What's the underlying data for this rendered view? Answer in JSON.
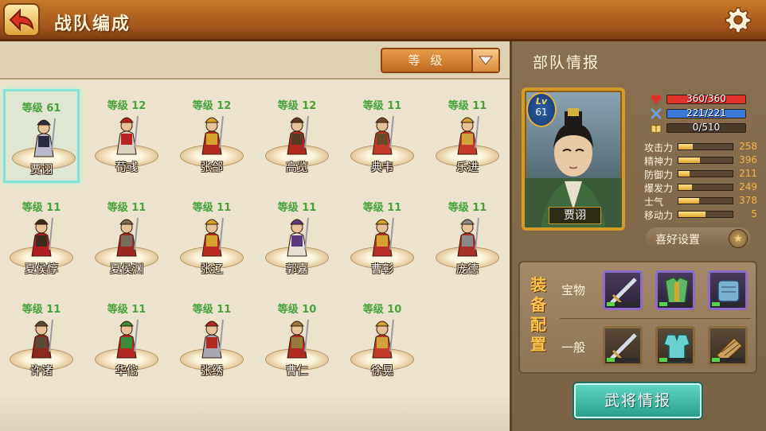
{
  "header": {
    "title": "战队编成",
    "back_icon": "back-arrow-icon",
    "settings_icon": "gear-icon"
  },
  "roster": {
    "sort_label": "等 级",
    "heroes": [
      {
        "level": "等级 61",
        "name": "贾诩",
        "color": "#b9b9c9",
        "accent": "#2a2a40",
        "selected": true
      },
      {
        "level": "等级 12",
        "name": "荀彧",
        "color": "#d9d4c0",
        "accent": "#b62222"
      },
      {
        "level": "等级 12",
        "name": "张郃",
        "color": "#b22a1f",
        "accent": "#d4a42c"
      },
      {
        "level": "等级 12",
        "name": "高览",
        "color": "#b22a1f",
        "accent": "#5a3a22"
      },
      {
        "level": "等级 11",
        "name": "典韦",
        "color": "#c33a2a",
        "accent": "#6b4a2a"
      },
      {
        "level": "等级 11",
        "name": "乐进",
        "color": "#c23a2a",
        "accent": "#d2a23a"
      },
      {
        "level": "等级 11",
        "name": "夏侯惇",
        "color": "#b02020",
        "accent": "#3a2a20"
      },
      {
        "level": "等级 11",
        "name": "夏侯渊",
        "color": "#9a2a22",
        "accent": "#7a6a5a"
      },
      {
        "level": "等级 11",
        "name": "张辽",
        "color": "#b82a22",
        "accent": "#d4a42c"
      },
      {
        "level": "等级 11",
        "name": "郭嘉",
        "color": "#e6e0d4",
        "accent": "#5a3a7a"
      },
      {
        "level": "等级 11",
        "name": "曹彰",
        "color": "#b8302a",
        "accent": "#d2a22c"
      },
      {
        "level": "等级 11",
        "name": "庞德",
        "color": "#a8302a",
        "accent": "#8a8a8a"
      },
      {
        "level": "等级 11",
        "name": "许诸",
        "color": "#8a2a1a",
        "accent": "#5a4a3a"
      },
      {
        "level": "等级 11",
        "name": "华佗",
        "color": "#b02a22",
        "accent": "#3a8a3a"
      },
      {
        "level": "等级 11",
        "name": "张绣",
        "color": "#a8a8b0",
        "accent": "#b02a22"
      },
      {
        "level": "等级 10",
        "name": "曹仁",
        "color": "#b02a22",
        "accent": "#9a7a3a"
      },
      {
        "level": "等级 10",
        "name": "徐晃",
        "color": "#c23a2a",
        "accent": "#d2a23a"
      }
    ]
  },
  "unit_info": {
    "title": "部队情报",
    "portrait": {
      "lv_label": "Lv",
      "level": "61",
      "name": "贾诩"
    },
    "bars": [
      {
        "icon": "heart-icon",
        "text": "360/360",
        "fraction": 1.0,
        "color": "#e0342a"
      },
      {
        "icon": "crossed-swords-icon",
        "text": "221/221",
        "fraction": 1.0,
        "color": "#3a78d8"
      },
      {
        "icon": "book-icon",
        "text": "0/510",
        "fraction": 0.0,
        "color": "#e0b030"
      }
    ],
    "stats": [
      {
        "label": "攻击力",
        "value": "258",
        "fraction": 0.26
      },
      {
        "label": "精神力",
        "value": "396",
        "fraction": 0.4
      },
      {
        "label": "防御力",
        "value": "211",
        "fraction": 0.21
      },
      {
        "label": "爆发力",
        "value": "249",
        "fraction": 0.25
      },
      {
        "label": "士气",
        "value": "378",
        "fraction": 0.38
      },
      {
        "label": "移动力",
        "value": "5",
        "fraction": 0.5
      }
    ],
    "favorite_button": "喜好设置",
    "favorite_icon": "star-icon",
    "equipment": {
      "title": "装备配置",
      "treasure_label": "宝物",
      "general_label": "一般",
      "treasure_slots": [
        {
          "icon": "sword-icon",
          "level_fraction": 0.25
        },
        {
          "icon": "armor-icon",
          "level_fraction": 0.25
        },
        {
          "icon": "scroll-icon",
          "level_fraction": 0.25
        }
      ],
      "general_slots": [
        {
          "icon": "sword-icon",
          "level_fraction": 0.25
        },
        {
          "icon": "robe-icon",
          "level_fraction": 0.25
        },
        {
          "icon": "bamboo-book-icon",
          "level_fraction": 0.25
        }
      ]
    },
    "generals_button": "武将情报"
  }
}
